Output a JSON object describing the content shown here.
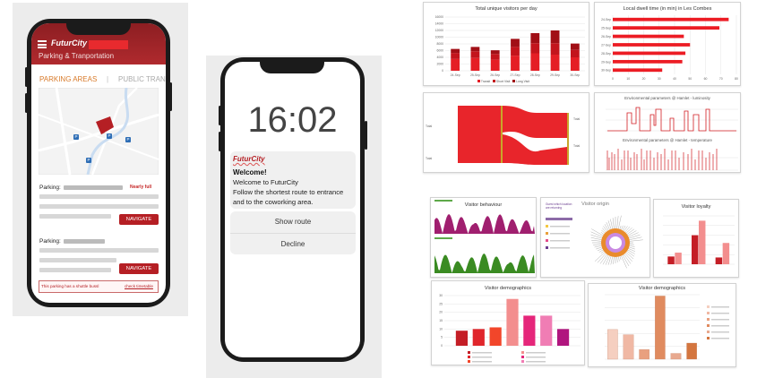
{
  "phone1": {
    "brand": "FuturCity",
    "subtitle": "Parking & Tranportation",
    "tab_active": "PARKING AREAS",
    "tab_separator": "|",
    "tab_inactive": "PUBLIC TRANS",
    "parking1_label": "Parking:",
    "parking1_status": "Nearly full",
    "navigate_label": "NAVIGATE",
    "parking2_label": "Parking:",
    "footer_text": "This parking has a shuttle bussl",
    "footer_link": "check timetable",
    "map_pins": [
      "P",
      "P",
      "P",
      "P"
    ]
  },
  "phone2": {
    "time": "16:02",
    "brand": "FuturCity",
    "welcome": "Welcome!",
    "line1": "Welcome to FuturCity",
    "line2": "Follow the shortest route to entrance",
    "line3": "and to the coworking area.",
    "action1": "Show route",
    "action2": "Decline"
  },
  "colors": {
    "brand_red": "#b51f24",
    "bar_red": "#ec1c24",
    "dark_red": "#c41e26",
    "pink": "#f38e8e",
    "green": "#3a8b22",
    "purple": "#a0206e"
  },
  "chart1": {
    "title": "Total unique visitors per day",
    "legend": [
      "Transit",
      "Short Visit",
      "Long Visit"
    ]
  },
  "chart2": {
    "title": "Local dwell time (in min) in Les Combes"
  },
  "chart3": {
    "left_label_top": "Total",
    "left_label_bottom": "Total",
    "right_label_top": "Total",
    "right_label_bottom": "Total"
  },
  "chart4": {
    "title_top": "Environmental parameters @ Hamlet - luminosity",
    "title_bottom": "Environmental parameters @ Hamlet - temperature"
  },
  "chart5": {
    "title": "Visitor behaviour"
  },
  "chart6": {
    "title": "Visitor origin",
    "text_heading": "Guest which location are returning"
  },
  "chart7": {
    "title": "Visitor loyalty"
  },
  "chart8": {
    "title": "Visitor demographics"
  },
  "chart9": {
    "title": "Visitor demographics"
  },
  "chart_data": [
    {
      "type": "bar",
      "title": "Total unique visitors per day",
      "categories": [
        "24-Sep",
        "25-Sep",
        "26-Sep",
        "27-Sep",
        "28-Sep",
        "29-Sep",
        "30-Sep"
      ],
      "series": [
        {
          "name": "Transit",
          "values": [
            3500,
            3800,
            3300,
            4500,
            5200,
            4800,
            4000
          ]
        },
        {
          "name": "Short Visit",
          "values": [
            1800,
            2000,
            1700,
            2600,
            3000,
            3400,
            2200
          ]
        },
        {
          "name": "Long Visit",
          "values": [
            1200,
            1300,
            1100,
            2400,
            3000,
            3800,
            1900
          ]
        }
      ],
      "ylim": [
        0,
        16000
      ],
      "yticks": [
        0,
        2000,
        4000,
        6000,
        8000,
        10000,
        12000,
        14000,
        16000
      ]
    },
    {
      "type": "bar",
      "title": "Local dwell time (in min) in Les Combes",
      "categories": [
        "24-Sep",
        "25-Sep",
        "26-Sep",
        "27-Sep",
        "28-Sep",
        "29-Sep",
        "30-Sep"
      ],
      "values": [
        75,
        69,
        46,
        50,
        47,
        45,
        32
      ],
      "xlim": [
        0,
        80
      ],
      "xticks": [
        0,
        10,
        20,
        30,
        40,
        50,
        60,
        70,
        80
      ]
    },
    {
      "type": "bar",
      "title": "Visitor demographics",
      "values": [
        9,
        10,
        11,
        28,
        18,
        18,
        10
      ],
      "ylim": [
        0,
        30
      ],
      "yticks": [
        0,
        5,
        10,
        15,
        20,
        25,
        30
      ]
    },
    {
      "type": "bar",
      "title": "Visitor demographics",
      "values": [
        46,
        38,
        15,
        98,
        9,
        25
      ],
      "ylim": [
        0,
        100
      ],
      "yticks": [
        0,
        20,
        40,
        60,
        80,
        100
      ]
    },
    {
      "type": "bar",
      "title": "Visitor loyalty",
      "series": [
        {
          "values": [
            8,
            30,
            7
          ]
        },
        {
          "values": [
            12,
            45,
            22
          ]
        }
      ],
      "ylim": [
        0,
        50
      ]
    }
  ]
}
